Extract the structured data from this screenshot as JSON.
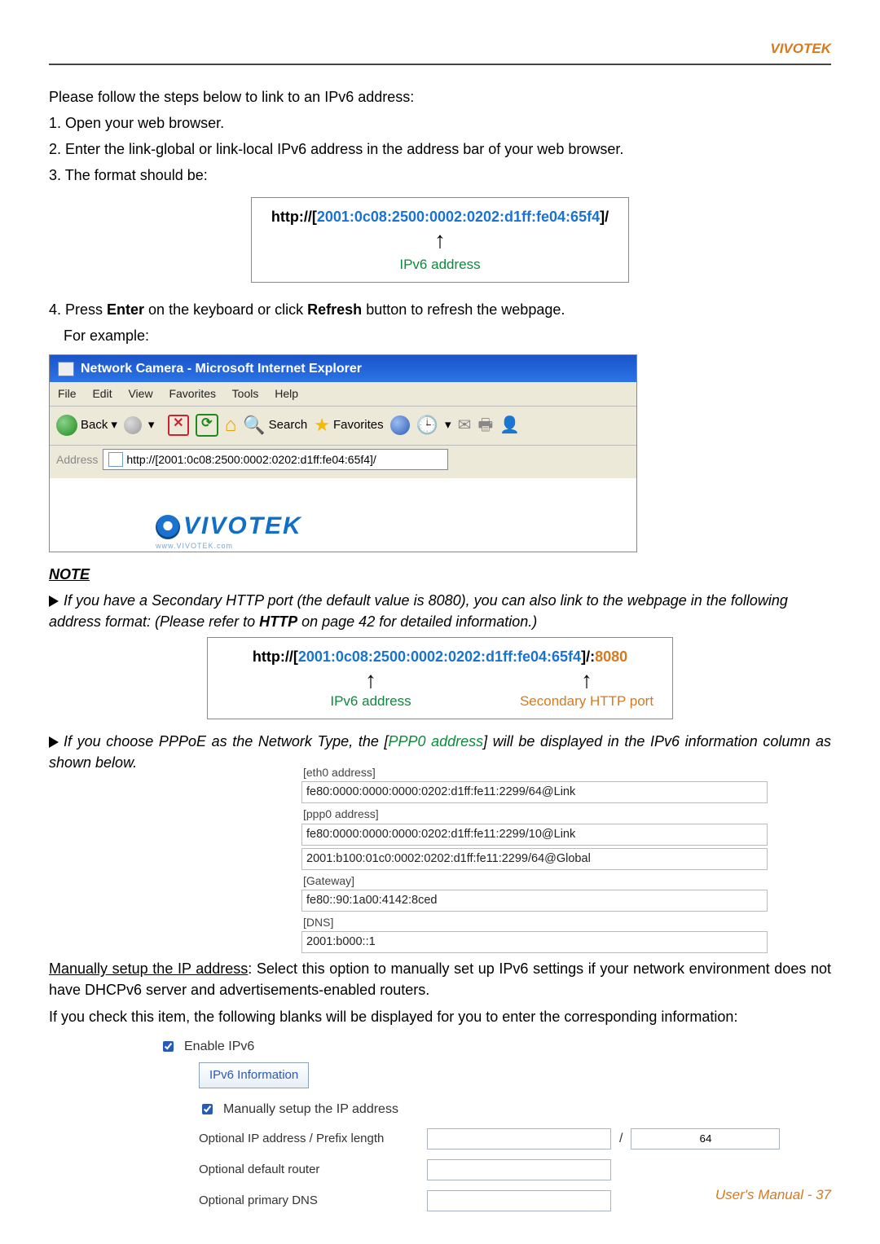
{
  "brand": "VIVOTEK",
  "intro": {
    "lead": "Please follow the steps below to link to an IPv6 address:",
    "s1": "1. Open your web browser.",
    "s2": "2. Enter the link-global or link-local IPv6 address in the address bar of your web browser.",
    "s3": "3. The format should be:"
  },
  "d1": {
    "prefix": "http://[",
    "addr": "2001:0c08:2500:0002:0202:d1ff:fe04:65f4",
    "suffix": "]/",
    "arrow": "↑",
    "label": "IPv6 address"
  },
  "step4a": "4. Press ",
  "step4b": "Enter",
  "step4c": " on the keyboard or click ",
  "step4d": "Refresh",
  "step4e": " button to refresh the webpage.",
  "step4_eg": "For example:",
  "ie": {
    "title": "Network Camera - Microsoft Internet Explorer",
    "menu": {
      "file": "File",
      "edit": "Edit",
      "view": "View",
      "fav": "Favorites",
      "tools": "Tools",
      "help": "Help"
    },
    "back": "Back",
    "search": "Search",
    "favorites": "Favorites",
    "addr_label": "Address",
    "addr_value": "http://[2001:0c08:2500:0002:0202:d1ff:fe04:65f4]/",
    "logo": "VIVOTEK",
    "logo_sub": "www.VIVOTEK.com"
  },
  "note": {
    "heading": "NOTE",
    "p1a": "If you have a Secondary HTTP port (the default value is 8080), you can also link to the webpage in the following address format: (Please refer to ",
    "p1b": "HTTP",
    "p1c": " on page 42 for detailed information.)"
  },
  "d2": {
    "prefix": "http://[",
    "addr": "2001:0c08:2500:0002:0202:d1ff:fe04:65f4",
    "suffix": "]/:",
    "port": "8080",
    "arrow": "↑",
    "label_a": "IPv6 address",
    "label_b": "Secondary HTTP port"
  },
  "pppoe": {
    "a": "If you choose PPPoE as the Network Type, the [",
    "b": "PPP0 address",
    "c": "] will be displayed in the IPv6 information column as shown below."
  },
  "info": {
    "eth0": "[eth0 address]",
    "eth0_v": "fe80:0000:0000:0000:0202:d1ff:fe11:2299/64@Link",
    "ppp0": "[ppp0 address]",
    "ppp0_v1": "fe80:0000:0000:0000:0202:d1ff:fe11:2299/10@Link",
    "ppp0_v2": "2001:b100:01c0:0002:0202:d1ff:fe11:2299/64@Global",
    "gw": "[Gateway]",
    "gw_v": "fe80::90:1a00:4142:8ced",
    "dns": "[DNS]",
    "dns_v": "2001:b000::1"
  },
  "manual": {
    "a": "Manually setup the IP address",
    "b": ": Select this option to manually set up IPv6 settings if your network environment does not have DHCPv6 server and advertisements-enabled routers.",
    "c": "If you check this item, the following blanks will be displayed for you to enter the corresponding information:"
  },
  "settings": {
    "enable": "Enable IPv6",
    "info_btn": "IPv6 Information",
    "manual": "Manually setup the IP address",
    "opt_ip": "Optional IP address / Prefix length",
    "prefix_val": "64",
    "slash": "/",
    "opt_router": "Optional default router",
    "opt_dns": "Optional primary DNS"
  },
  "footer": "User's Manual - 37"
}
